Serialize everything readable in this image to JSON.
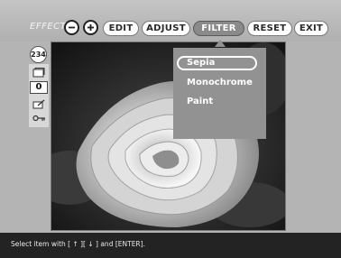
{
  "toolbar": {
    "effect_label": "EFFECT",
    "zoom_out_icon": "zoom-out-icon",
    "zoom_in_icon": "zoom-in-icon",
    "buttons": [
      {
        "label": "EDIT"
      },
      {
        "label": "ADJUST"
      },
      {
        "label": "FILTER",
        "active": true
      },
      {
        "label": "RESET"
      },
      {
        "label": "EXIT"
      }
    ]
  },
  "sidebar": {
    "image_count": "234",
    "print_quantity": "0",
    "icons": [
      "print-copies-icon",
      "print-edit-icon",
      "protect-key-icon"
    ]
  },
  "filter_menu": {
    "items": [
      {
        "label": "Sepia",
        "selected": true
      },
      {
        "label": "Monochrome",
        "selected": false
      },
      {
        "label": "Paint",
        "selected": false
      }
    ]
  },
  "status": {
    "instruction": "Select item with [ ↑ ][ ↓ ] and [ENTER]."
  },
  "colors": {
    "background": "#b4b4b4",
    "menu_bg": "#929292",
    "status_bg": "#232323",
    "active_button": "#8a8a8a"
  }
}
